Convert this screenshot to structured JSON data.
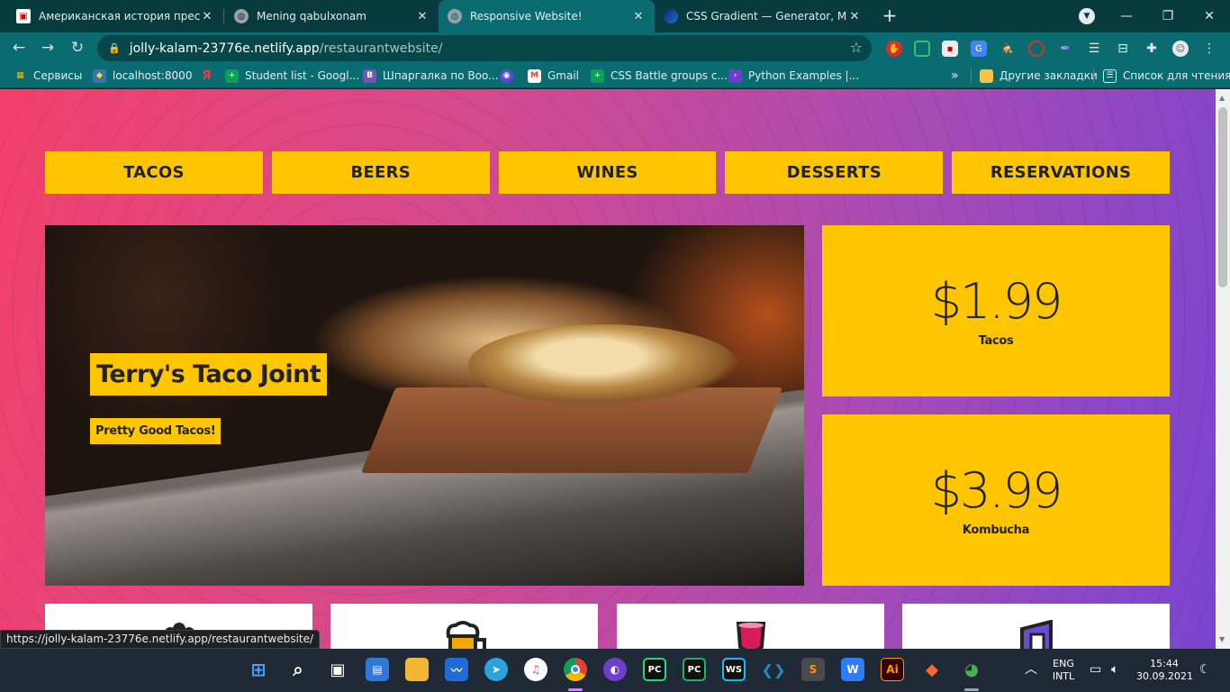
{
  "tabs": [
    {
      "title": "Американская история преступ",
      "icon_color": "#ffffff"
    },
    {
      "title": "Mening qabulxonam",
      "icon_color": "#9aa0a6"
    },
    {
      "title": "Responsive Website!",
      "icon_color": "#9aa0a6"
    },
    {
      "title": "CSS Gradient — Generator, Make",
      "icon_color": "#1e6fd9"
    }
  ],
  "window": {
    "profile_icon": "chevron-down-icon",
    "minimize": "—",
    "restore": "❐",
    "close": "✕"
  },
  "address": {
    "host": "jolly-kalam-23776e.netlify.app",
    "path": "/restaurantwebsite/"
  },
  "bookmarks": [
    {
      "label": "Сервисы",
      "color": "#4285f4",
      "glyph": "▦"
    },
    {
      "label": "localhost:8000",
      "color": "#3776ab",
      "glyph": "🐍"
    },
    {
      "label": "",
      "color": "#0a6c70",
      "glyph": "Я"
    },
    {
      "label": "Student list - Googl...",
      "color": "#0f9d58",
      "glyph": "+"
    },
    {
      "label": "Шпаргалка по Boo...",
      "color": "#7952b3",
      "glyph": "B"
    },
    {
      "label": "",
      "color": "#5b4ad6",
      "glyph": "◉"
    },
    {
      "label": "Gmail",
      "color": "#ffffff",
      "glyph": "M"
    },
    {
      "label": "CSS Battle groups c...",
      "color": "#0f9d58",
      "glyph": "+"
    },
    {
      "label": "Python Examples |...",
      "color": "#6d3bd6",
      "glyph": "›"
    }
  ],
  "bookmarks_right": [
    {
      "label": "Другие закладки",
      "color": "#f6c344",
      "glyph": "▮"
    },
    {
      "label": "Список для чтения",
      "color": "#0a6c70",
      "glyph": "☰"
    }
  ],
  "site": {
    "nav": [
      "TACOS",
      "BEERS",
      "WINES",
      "DESSERTS",
      "RESERVATIONS"
    ],
    "hero_title": "Terry's Taco Joint",
    "hero_subtitle": "Pretty Good Tacos!",
    "prices": [
      {
        "amount": "$1.99",
        "label": "Tacos"
      },
      {
        "amount": "$3.99",
        "label": "Kombucha"
      }
    ],
    "accent": "#ffc600"
  },
  "status_url": "https://jolly-kalam-23776e.netlify.app/restaurantwebsite/",
  "taskbar": {
    "lang": "ENG",
    "layout": "INTL",
    "time": "15:44",
    "date": "30.09.2021",
    "apps": [
      {
        "name": "start",
        "glyph": "⊞",
        "color": "#3b8ee8"
      },
      {
        "name": "search",
        "glyph": "⌕",
        "color": "transparent"
      },
      {
        "name": "task-view",
        "glyph": "▣",
        "color": "transparent"
      },
      {
        "name": "widgets",
        "glyph": "▤",
        "color": "#2f78d8"
      },
      {
        "name": "file-explorer",
        "glyph": "▬",
        "color": "#f2b632"
      },
      {
        "name": "whiteboard",
        "glyph": "〰",
        "color": "#1e6cd6"
      },
      {
        "name": "telegram",
        "glyph": "➤",
        "color": "#2aa3df"
      },
      {
        "name": "itunes",
        "glyph": "♫",
        "color": "#ea4c89"
      },
      {
        "name": "chrome",
        "glyph": "◎",
        "color": "#db4437"
      },
      {
        "name": "github",
        "glyph": "◐",
        "color": "#6e40c9"
      },
      {
        "name": "pycharm-ce",
        "glyph": "PC",
        "color": "#21d789"
      },
      {
        "name": "pycharm",
        "glyph": "PC",
        "color": "#1bb36b"
      },
      {
        "name": "webstorm",
        "glyph": "WS",
        "color": "#07c3f2"
      },
      {
        "name": "vscode",
        "glyph": "❮❯",
        "color": "#1f8ad2"
      },
      {
        "name": "sublime",
        "glyph": "S",
        "color": "#ff9800"
      },
      {
        "name": "wps",
        "glyph": "W",
        "color": "#2f7cf6"
      },
      {
        "name": "illustrator",
        "glyph": "Ai",
        "color": "#330000"
      },
      {
        "name": "origin",
        "glyph": "◆",
        "color": "#f56c2d"
      },
      {
        "name": "other-app",
        "glyph": "◕",
        "color": "#4caf50"
      }
    ]
  }
}
